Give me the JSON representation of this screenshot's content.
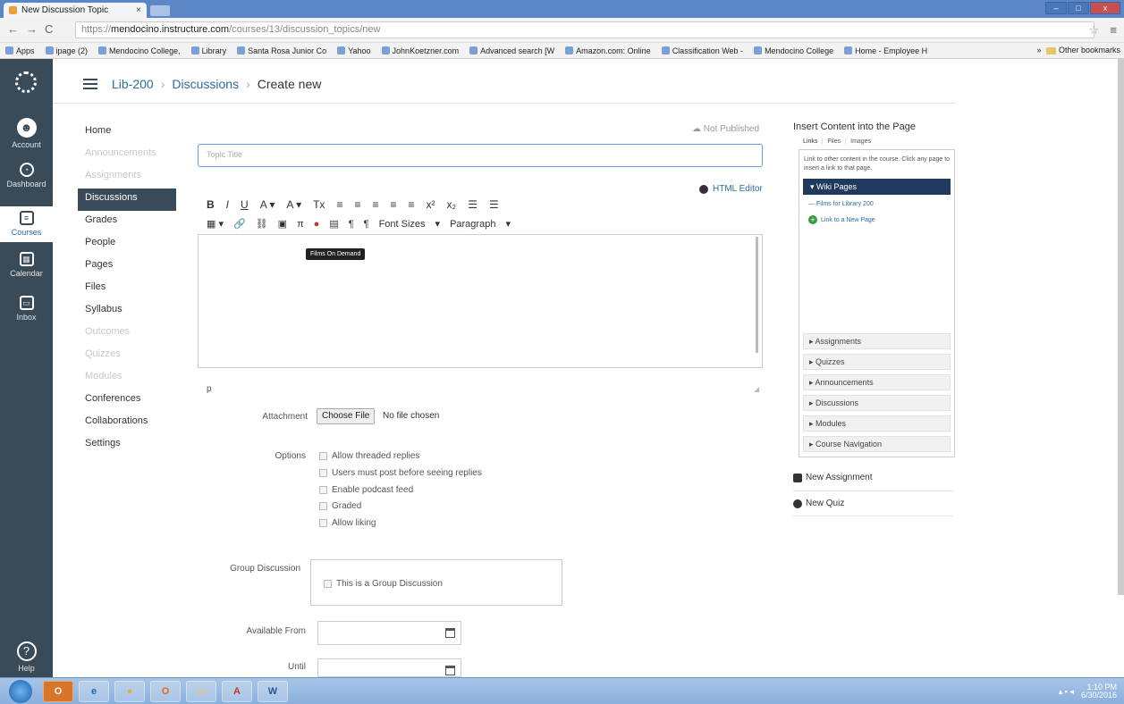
{
  "browser": {
    "tab_title": "New Discussion Topic",
    "tab_close": "×",
    "url_scheme": "https://",
    "url_host": "mendocino.instructure.com",
    "url_path": "/courses/13/discussion_topics/new",
    "bookmarks": [
      "Apps",
      "ipage (2)",
      "Mendocino College, ",
      "Library",
      "Santa Rosa Junior Co",
      "Yahoo",
      "JohnKoetzner.com",
      "Advanced search [W",
      "Amazon.com: Online",
      "Classification Web - ",
      "Mendocino College ",
      "Home - Employee H"
    ],
    "bookmarks_overflow": "»",
    "other_bookmarks": "Other bookmarks"
  },
  "global_nav": [
    {
      "label": "Account",
      "icon": "account-icon"
    },
    {
      "label": "Dashboard",
      "icon": "dashboard-icon"
    },
    {
      "label": "Courses",
      "icon": "courses-icon"
    },
    {
      "label": "Calendar",
      "icon": "calendar-icon"
    },
    {
      "label": "Inbox",
      "icon": "inbox-icon"
    },
    {
      "label": "Help",
      "icon": "help-icon"
    }
  ],
  "breadcrumb": {
    "course": "Lib-200",
    "section": "Discussions",
    "current": "Create new",
    "sep": "›"
  },
  "course_nav": [
    {
      "label": "Home",
      "state": "normal"
    },
    {
      "label": "Announcements",
      "state": "dim"
    },
    {
      "label": "Assignments",
      "state": "dim"
    },
    {
      "label": "Discussions",
      "state": "active"
    },
    {
      "label": "Grades",
      "state": "normal"
    },
    {
      "label": "People",
      "state": "normal"
    },
    {
      "label": "Pages",
      "state": "normal"
    },
    {
      "label": "Files",
      "state": "normal"
    },
    {
      "label": "Syllabus",
      "state": "normal"
    },
    {
      "label": "Outcomes",
      "state": "dim"
    },
    {
      "label": "Quizzes",
      "state": "dim"
    },
    {
      "label": "Modules",
      "state": "dim"
    },
    {
      "label": "Conferences",
      "state": "normal"
    },
    {
      "label": "Collaborations",
      "state": "normal"
    },
    {
      "label": "Settings",
      "state": "normal"
    }
  ],
  "form": {
    "publish_status": "Not Published",
    "topic_placeholder": "Topic Title",
    "html_editor": "HTML Editor",
    "toolbar_row1": [
      "B",
      "I",
      "U",
      "A ▾",
      "A ▾",
      "Tx",
      "≡",
      "≡",
      "≡",
      "≡",
      "≡",
      "x²",
      "x₂",
      "☰",
      "☰"
    ],
    "toolbar_row2": [
      "▦ ▾",
      "🔗",
      "⛓",
      "▣",
      "π",
      "●",
      "▤",
      "¶",
      "¶",
      "Font Sizes",
      "▾",
      "Paragraph",
      "▾"
    ],
    "tooltip": "Films On Demand",
    "path": "p",
    "attachment_label": "Attachment",
    "choose_file": "Choose File",
    "no_file": "No file chosen",
    "options_label": "Options",
    "options": [
      "Allow threaded replies",
      "Users must post before seeing replies",
      "Enable podcast feed",
      "Graded",
      "Allow liking"
    ],
    "group_label": "Group Discussion",
    "group_option": "This is a Group Discussion",
    "available_from": "Available From",
    "until": "Until"
  },
  "right_panel": {
    "title": "Insert Content into the Page",
    "tabs": [
      "Links",
      "Files",
      "Images"
    ],
    "description": "Link to other content in the course. Click any page to insert a link to that page.",
    "wiki_header": "▾ Wiki Pages",
    "wiki_items": [
      "— Films for Library 200"
    ],
    "new_page_link": "Link to a New Page",
    "sections": [
      "▸ Assignments",
      "▸ Quizzes",
      "▸ Announcements",
      "▸ Discussions",
      "▸ Modules",
      "▸ Course Navigation"
    ],
    "new_assignment": "New Assignment",
    "new_quiz": "New Quiz"
  },
  "taskbar": {
    "time": "1:10 PM",
    "date": "6/30/2016"
  },
  "colors": {
    "nav_bg": "#394b58",
    "link": "#2d6ca2",
    "wiki_header": "#1f3a5c"
  }
}
